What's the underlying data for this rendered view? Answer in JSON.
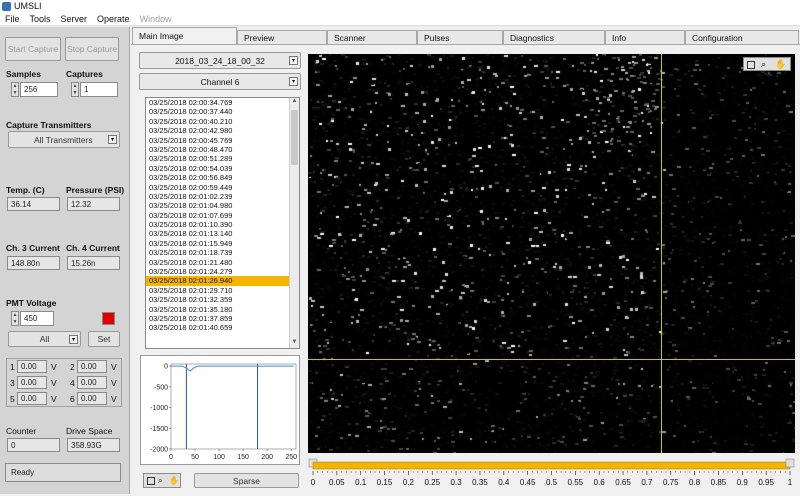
{
  "window": {
    "title": "UMSLI"
  },
  "menu": [
    "File",
    "Tools",
    "Server",
    "Operate",
    "Window"
  ],
  "left": {
    "start_capture": "Start Capture",
    "stop_capture": "Stop Capture",
    "samples_label": "Samples",
    "samples_value": "256",
    "captures_label": "Captures",
    "captures_value": "1",
    "capture_transmitters_label": "Capture Transmitters",
    "capture_transmitters_value": "All Transmitters",
    "temp_label": "Temp. (C)",
    "temp_value": "36.14",
    "pressure_label": "Pressure (PSI)",
    "pressure_value": "12.32",
    "ch3_label": "Ch. 3 Current",
    "ch3_value": "148.80n",
    "ch4_label": "Ch. 4 Current",
    "ch4_value": "15.26n",
    "pmt_label": "PMT Voltage",
    "pmt_value": "450",
    "pmt_select": "All",
    "set_button": "Set",
    "voltages": [
      {
        "index": "1",
        "value": "0.00",
        "unit": "V"
      },
      {
        "index": "2",
        "value": "0.00",
        "unit": "V"
      },
      {
        "index": "3",
        "value": "0.00",
        "unit": "V"
      },
      {
        "index": "4",
        "value": "0.00",
        "unit": "V"
      },
      {
        "index": "5",
        "value": "0.00",
        "unit": "V"
      },
      {
        "index": "6",
        "value": "0.00",
        "unit": "V"
      }
    ],
    "counter_label": "Counter",
    "counter_value": "0",
    "drive_label": "Drive Space",
    "drive_value": "358.93G",
    "status": "Ready",
    "colors": {
      "stop_indicator": "#e00000"
    }
  },
  "tabs": [
    "Main Image",
    "Preview",
    "Scanner",
    "Pulses",
    "Diagnostics",
    "Info",
    "Configuration"
  ],
  "main": {
    "dataset_select": "2018_03_24_18_00_32",
    "channel_select": "Channel 6",
    "files": [
      "03/25/2018 02:00:34.769",
      "03/25/2018 02:00:37.440",
      "03/25/2018 02:00:40.210",
      "03/25/2018 02:00:42.980",
      "03/25/2018 02:00:45.769",
      "03/25/2018 02:00:48.470",
      "03/25/2018 02:00:51.289",
      "03/25/2018 02:00:54.039",
      "03/25/2018 02:00:56.849",
      "03/25/2018 02:00:59.449",
      "03/25/2018 02:01:02.239",
      "03/25/2018 02:01:04.980",
      "03/25/2018 02:01:07.699",
      "03/25/2018 02:01:10.390",
      "03/25/2018 02:01:13.140",
      "03/25/2018 02:01:15.949",
      "03/25/2018 02:01:18.739",
      "03/25/2018 02:01:21.480",
      "03/25/2018 02:01:24.279",
      "03/25/2018 02:01:26.940",
      "03/25/2018 02:01:29.710",
      "03/25/2018 02:01:32.359",
      "03/25/2018 02:01:35.180",
      "03/25/2018 02:01:37.859",
      "03/25/2018 02:01:40.659"
    ],
    "selected_index": 19,
    "sparse_button": "Sparse",
    "colors": {
      "selection": "#f5b400",
      "cursor": "#c8c800",
      "slider_fill": "#f5b400"
    }
  },
  "mini_chart": {
    "type": "line",
    "x": [
      0,
      8,
      16,
      24,
      32,
      40,
      48,
      56,
      64,
      96,
      128,
      160,
      176,
      192,
      224,
      255
    ],
    "y": [
      0,
      0,
      0,
      0,
      -50,
      -120,
      -40,
      0,
      0,
      0,
      0,
      0,
      0,
      0,
      0,
      0
    ],
    "xlim": [
      0,
      260
    ],
    "ylim": [
      -2000,
      50
    ],
    "xticks": [
      0,
      50,
      100,
      150,
      200,
      250
    ],
    "yticks": [
      0,
      -500,
      -1000,
      -1500,
      -2000
    ],
    "cursors_x": [
      32,
      180
    ]
  },
  "slider": {
    "ticks": [
      "0",
      "0.05",
      "0.1",
      "0.15",
      "0.2",
      "0.25",
      "0.3",
      "0.35",
      "0.4",
      "0.45",
      "0.5",
      "0.55",
      "0.6",
      "0.65",
      "0.7",
      "0.75",
      "0.8",
      "0.85",
      "0.9",
      "0.95",
      "1"
    ],
    "min": 0,
    "max": 1,
    "value": 1
  },
  "image": {
    "cursor_x": 0.725,
    "cursor_y": 0.765
  }
}
